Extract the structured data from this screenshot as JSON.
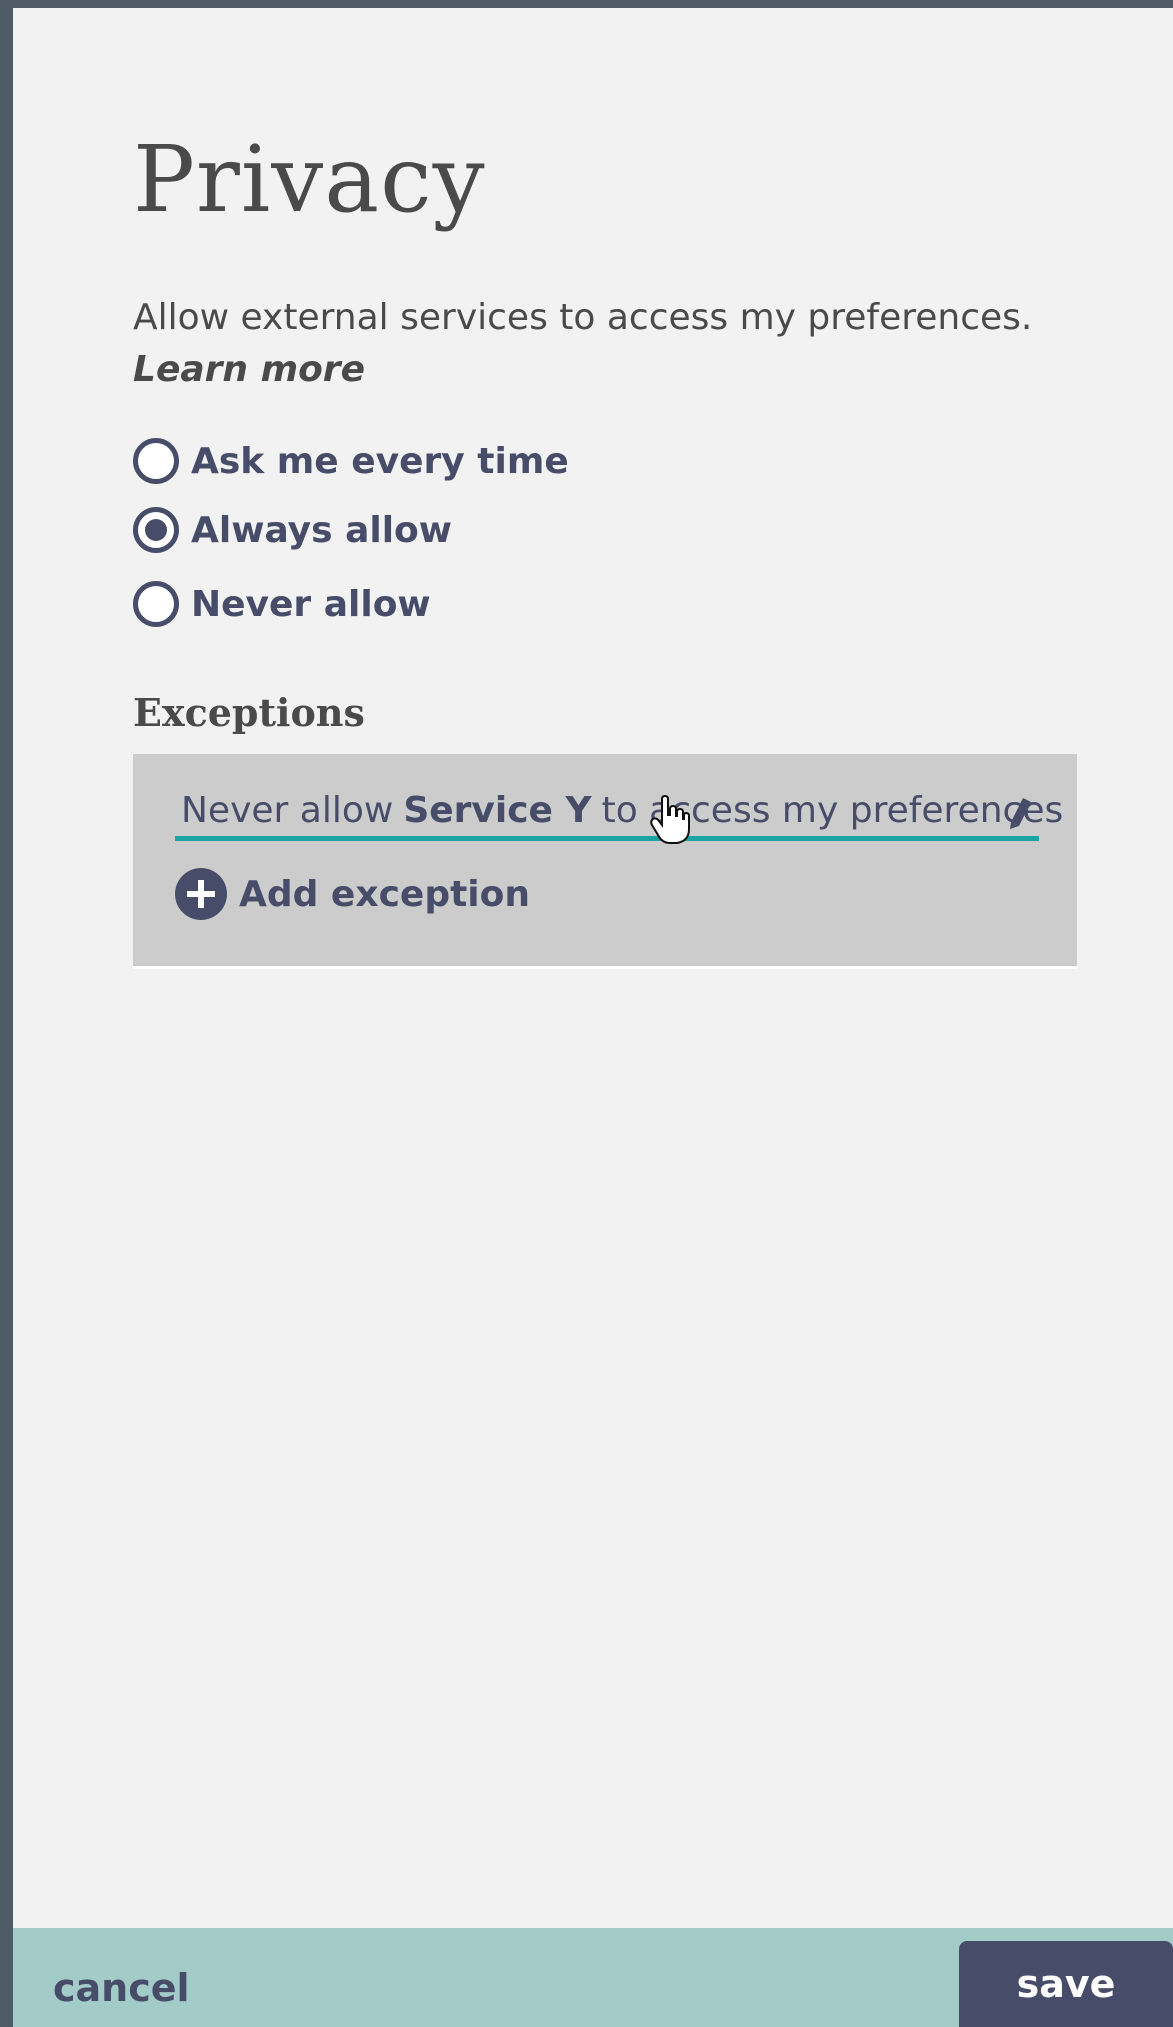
{
  "page": {
    "title": "Privacy",
    "description": "Allow external services to access my preferences.",
    "learn_more": "Learn more"
  },
  "options": [
    {
      "label": "Ask me every time",
      "selected": false
    },
    {
      "label": "Always allow",
      "selected": true
    },
    {
      "label": "Never allow",
      "selected": false
    }
  ],
  "exceptions": {
    "heading": "Exceptions",
    "items": [
      {
        "prefix": "Never allow",
        "service": "Service Y",
        "suffix": "to access my preferences"
      }
    ],
    "add_label": "Add exception"
  },
  "footer": {
    "cancel_label": "cancel",
    "save_label": "save"
  },
  "colors": {
    "accent": "#474c69",
    "underline": "#1aa3a0",
    "footer_bg": "#a3cbc8",
    "panel_bg": "#f2f2f2",
    "exceptions_bg": "#cccccc"
  },
  "icons": [
    "radio-unchecked-icon",
    "radio-checked-icon",
    "pencil-icon",
    "plus-circle-icon",
    "hand-cursor-icon"
  ]
}
